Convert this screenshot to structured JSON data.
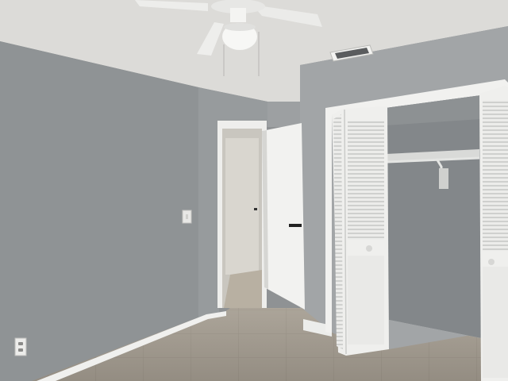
{
  "scene": {
    "subject": "empty-bedroom",
    "colors": {
      "wall_left": "#8f9395",
      "wall_right": "#a3a6a8",
      "ceiling": "#dddcda",
      "floor": "#a19a8f",
      "trim": "#f0f0ee",
      "closet_interior": "#84888b"
    },
    "icons": [
      "ceiling-fan-icon",
      "hvac-vent-icon",
      "outlet-icon",
      "light-switch-icon"
    ]
  }
}
